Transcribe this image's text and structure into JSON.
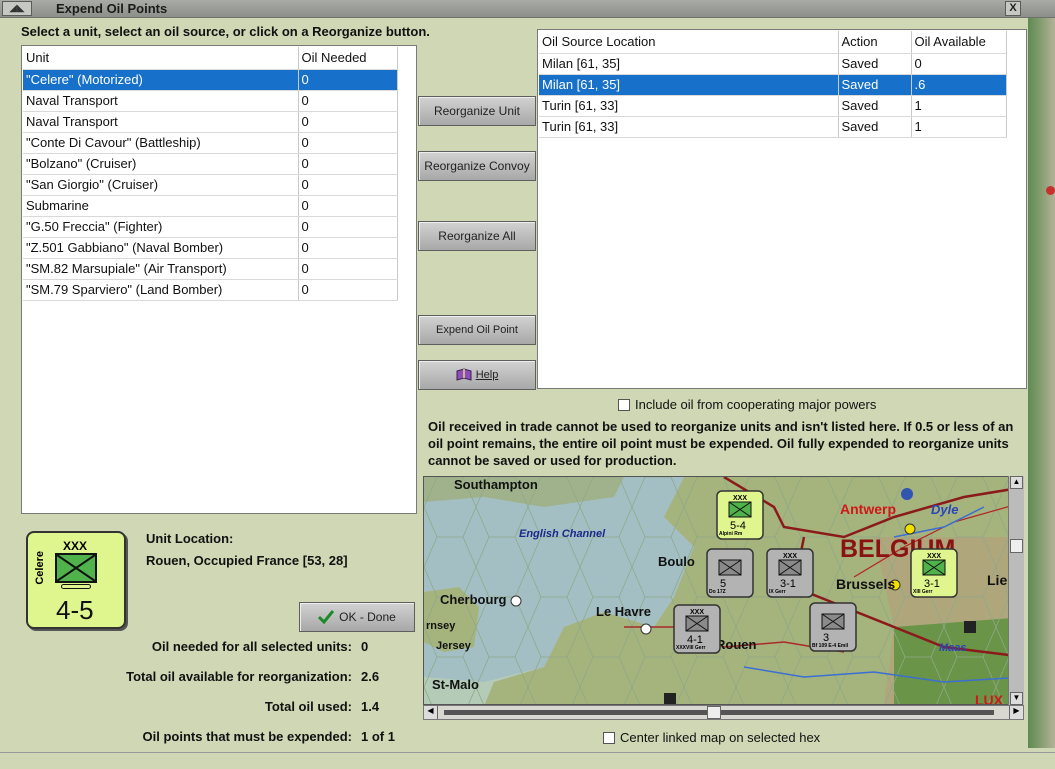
{
  "window": {
    "title": "Expend Oil Points",
    "close_label": "X"
  },
  "instruction": "Select a unit, select an oil source, or click on a Reorganize button.",
  "units_table": {
    "headers": [
      "Unit",
      "Oil Needed"
    ],
    "rows": [
      {
        "unit": "\"Celere\" (Motorized)",
        "oil": "0"
      },
      {
        "unit": "Naval Transport",
        "oil": "0"
      },
      {
        "unit": "Naval Transport",
        "oil": "0"
      },
      {
        "unit": "\"Conte Di Cavour\" (Battleship)",
        "oil": "0"
      },
      {
        "unit": "\"Bolzano\" (Cruiser)",
        "oil": "0"
      },
      {
        "unit": "\"San Giorgio\" (Cruiser)",
        "oil": "0"
      },
      {
        "unit": "Submarine",
        "oil": "0"
      },
      {
        "unit": "\"G.50 Freccia\" (Fighter)",
        "oil": "0"
      },
      {
        "unit": "\"Z.501 Gabbiano\" (Naval Bomber)",
        "oil": "0"
      },
      {
        "unit": "\"SM.82 Marsupiale\" (Air Transport)",
        "oil": "0"
      },
      {
        "unit": "\"SM.79 Sparviero\" (Land Bomber)",
        "oil": "0"
      }
    ],
    "selected_index": 0
  },
  "buttons": {
    "reorganize_unit": "Reorganize Unit",
    "reorganize_convoy": "Reorganize Convoy",
    "reorganize_all": "Reorganize All",
    "expend_oil_point": "Expend Oil Point",
    "help": "Help",
    "ok_done": "OK - Done"
  },
  "oil_table": {
    "headers": [
      "Oil Source Location",
      "Action",
      "Oil Available"
    ],
    "rows": [
      {
        "location": "Milan [61, 35]",
        "action": "Saved",
        "available": "0"
      },
      {
        "location": "Milan [61, 35]",
        "action": "Saved",
        "available": ".6"
      },
      {
        "location": "Turin [61, 33]",
        "action": "Saved",
        "available": "1"
      },
      {
        "location": "Turin [61, 33]",
        "action": "Saved",
        "available": "1"
      }
    ],
    "selected_index": 1
  },
  "include_cooperating_label": "Include oil from cooperating major powers",
  "note": "Oil received in trade cannot be used to reorganize units and isn't listed here.  If 0.5 or less of an oil point remains, the entire oil point must be expended.   Oil fully expended to reorganize units cannot be saved or used for production.",
  "counter": {
    "size": "XXX",
    "name": "Celere",
    "strength": "4-5",
    "color": "#dff58e"
  },
  "unit_location": {
    "label": "Unit Location:",
    "value": "Rouen, Occupied France [53, 28]"
  },
  "stats": [
    {
      "label": "Oil needed for all selected units:",
      "value": "0"
    },
    {
      "label": "Total oil available for reorganization:",
      "value": "2.6"
    },
    {
      "label": "Total oil used:",
      "value": "1.4"
    },
    {
      "label": "Oil points that must be expended:",
      "value": "1 of 1"
    }
  ],
  "center_linked_label": "Center linked map on selected hex",
  "map": {
    "labels": [
      "Southampton",
      "English Channel",
      "Cherbourg",
      "Le Havre",
      "Boulo",
      "Rouen",
      "Jersey",
      "rnsey",
      "St-Malo",
      "Antwerp",
      "Dyle",
      "BELGIUM",
      "Brussels",
      "Lie",
      "Maas",
      "LUX"
    ],
    "counters": [
      {
        "size": "XXX",
        "strength": "5-4",
        "name": "Alpini Rm"
      },
      {
        "size": "XXX",
        "strength": "3-1",
        "name": "IX Gerr"
      },
      {
        "size": "XXX",
        "strength": "3-1",
        "name": "XIII Gerr"
      },
      {
        "size": "XXX",
        "strength": "4-1",
        "name": "XXXVIII Gerr"
      },
      {
        "size": "",
        "strength": "5",
        "name": "Do 17Z"
      },
      {
        "size": "",
        "strength": "3",
        "name": "Bf 109 E-4 Emil"
      }
    ]
  }
}
